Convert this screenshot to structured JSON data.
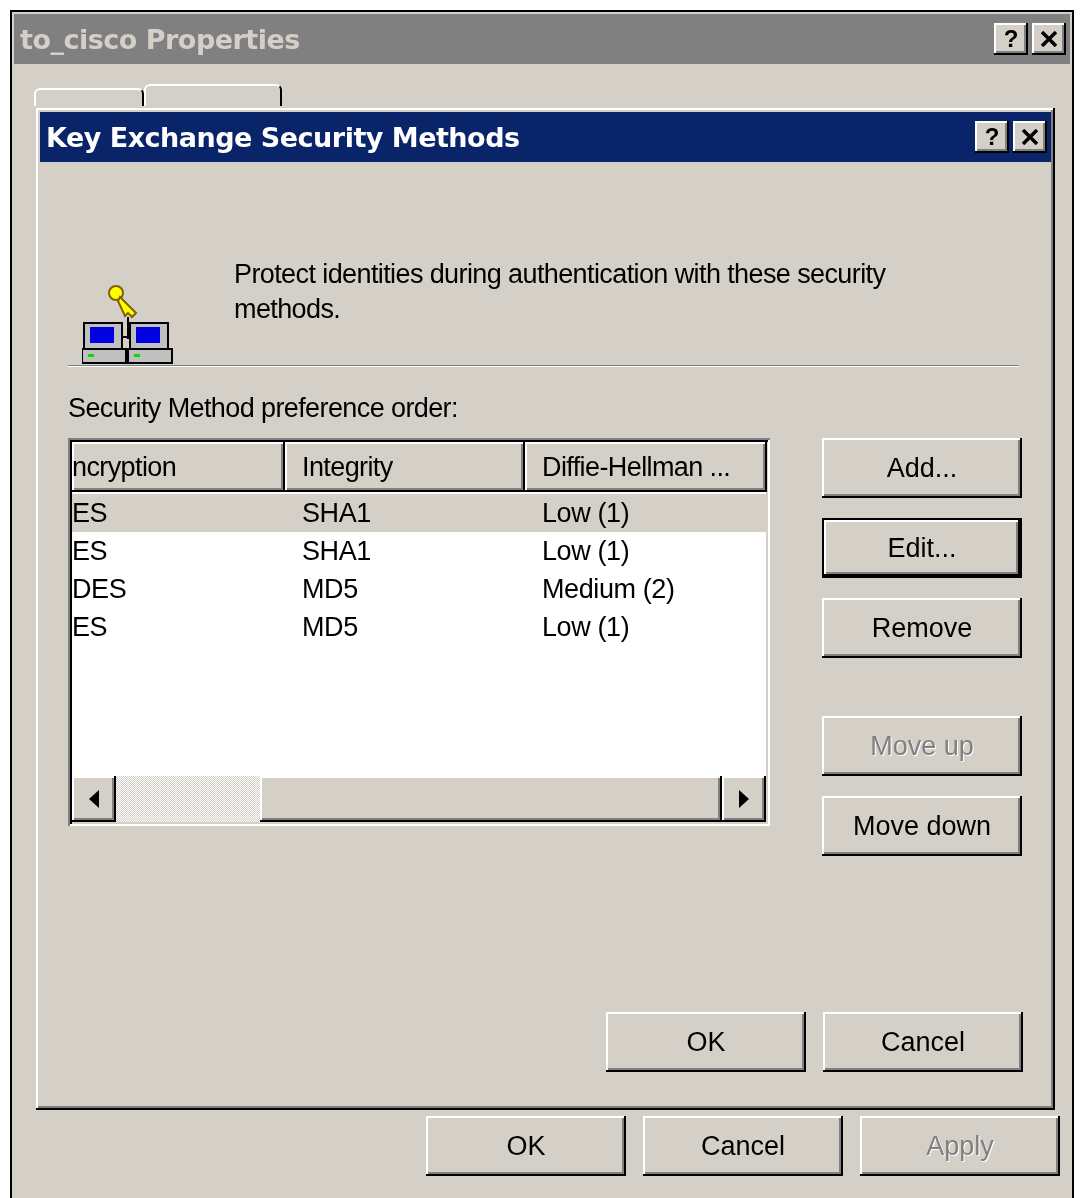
{
  "outer_window": {
    "title": "to_cisco Properties",
    "active": false,
    "help_glyph": "?",
    "tabs": [
      {
        "selected": false
      },
      {
        "selected": true
      }
    ],
    "buttons": [
      {
        "label": "OK",
        "disabled": false
      },
      {
        "label": "Cancel",
        "disabled": false
      },
      {
        "label": "Apply",
        "disabled": true
      }
    ]
  },
  "dialog": {
    "title": "Key Exchange Security Methods",
    "active": true,
    "help_glyph": "?",
    "description": "Protect identities during authentication with these security methods.",
    "list_label": "Security Method preference order:",
    "table": {
      "columns": [
        "ncryption",
        "Integrity",
        "Diffie-Hellman ..."
      ],
      "rows": [
        {
          "cells": [
            "ES",
            "SHA1",
            "Low (1)"
          ],
          "selected": true
        },
        {
          "cells": [
            "ES",
            "SHA1",
            "Low (1)"
          ],
          "selected": false
        },
        {
          "cells": [
            "DES",
            "MD5",
            "Medium (2)"
          ],
          "selected": false
        },
        {
          "cells": [
            "ES",
            "MD5",
            "Low (1)"
          ],
          "selected": false
        }
      ]
    },
    "side_buttons": [
      {
        "label": "Add...",
        "disabled": false,
        "default": false
      },
      {
        "label": "Edit...",
        "disabled": false,
        "default": true
      },
      {
        "label": "Remove",
        "disabled": false,
        "default": false
      },
      {
        "label": "Move up",
        "disabled": true,
        "default": false
      },
      {
        "label": "Move down",
        "disabled": false,
        "default": false
      }
    ],
    "buttons": [
      {
        "label": "OK",
        "disabled": false
      },
      {
        "label": "Cancel",
        "disabled": false
      }
    ]
  }
}
